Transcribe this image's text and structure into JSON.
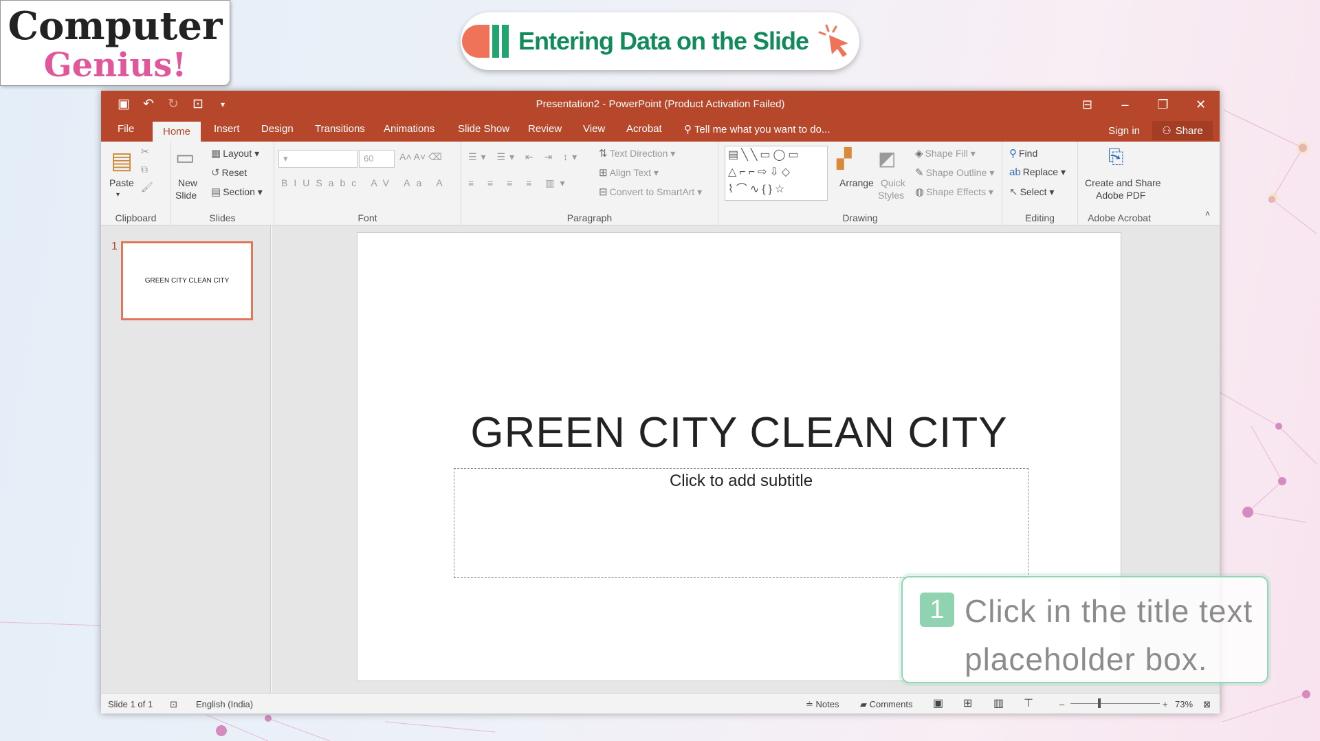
{
  "logo": {
    "line1": "Computer",
    "line2": "Genius!"
  },
  "banner": {
    "text": "Entering Data on the Slide"
  },
  "window": {
    "title": "Presentation2 - PowerPoint (Product Activation Failed)"
  },
  "tabs": [
    "File",
    "Home",
    "Insert",
    "Design",
    "Transitions",
    "Animations",
    "Slide Show",
    "Review",
    "View",
    "Acrobat"
  ],
  "tell_me": "Tell me what you want to do...",
  "sign_in": "Sign in",
  "share": "Share",
  "ribbon": {
    "clipboard": {
      "paste": "Paste",
      "label": "Clipboard"
    },
    "slides": {
      "new_slide_1": "New",
      "new_slide_2": "Slide",
      "layout": "Layout",
      "reset": "Reset",
      "section": "Section",
      "label": "Slides"
    },
    "font": {
      "size": "60",
      "label": "Font"
    },
    "paragraph": {
      "text_direction": "Text Direction",
      "align_text": "Align Text",
      "convert": "Convert to SmartArt",
      "label": "Paragraph"
    },
    "drawing": {
      "arrange": "Arrange",
      "quick_1": "Quick",
      "quick_2": "Styles",
      "shape_fill": "Shape Fill",
      "shape_outline": "Shape Outline",
      "shape_effects": "Shape Effects",
      "label": "Drawing"
    },
    "editing": {
      "find": "Find",
      "replace": "Replace",
      "select": "Select",
      "label": "Editing"
    },
    "acrobat": {
      "btn_1": "Create and Share",
      "btn_2": "Adobe PDF",
      "label": "Adobe Acrobat"
    }
  },
  "thumbnail": {
    "number": "1",
    "text": "GREEN CITY CLEAN CITY"
  },
  "slide": {
    "title": "GREEN CITY CLEAN CITY",
    "subtitle": "Click to add subtitle"
  },
  "status": {
    "slide": "Slide 1 of 1",
    "language": "English (India)",
    "notes": "Notes",
    "comments": "Comments",
    "zoom": "73%"
  },
  "callout": {
    "num": "1",
    "text": "Click in the title text placeholder box."
  },
  "colors": {
    "accent": "#b7472a",
    "banner_text": "#138a5c",
    "logo_pink": "#e0579a",
    "callout_green": "#8fd3b0"
  }
}
